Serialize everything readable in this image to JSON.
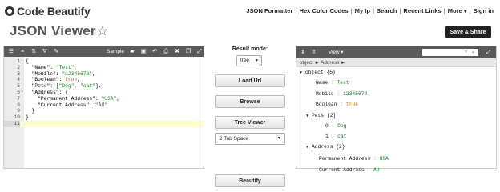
{
  "brand": {
    "name": "Code Beautify"
  },
  "nav": [
    "JSON Formatter",
    "Hex Color Codes",
    "My Ip",
    "Search",
    "Recent Links",
    "More ▾",
    "Sign in"
  ],
  "page": {
    "title": "JSON Viewer",
    "save_share": "Save & Share"
  },
  "editor": {
    "sample_label": "Sample",
    "line_numbers": [
      "1",
      "2",
      "3",
      "4",
      "5",
      "6",
      "7",
      "8",
      "9",
      "10",
      "11"
    ],
    "fold_markers": [
      "▾",
      "",
      "",
      "",
      "",
      "▾",
      "",
      "",
      "",
      "",
      ""
    ],
    "code": [
      {
        "parts": [
          [
            "k",
            "{"
          ]
        ]
      },
      {
        "parts": [
          [
            "k",
            "  \"Name\": "
          ],
          [
            "s",
            "\"Test\""
          ],
          [
            "k",
            ","
          ]
        ]
      },
      {
        "parts": [
          [
            "k",
            "  \"Mobile\": "
          ],
          [
            "s",
            "\"12345678\""
          ],
          [
            "k",
            ","
          ]
        ]
      },
      {
        "parts": [
          [
            "k",
            "  \"Boolean\": "
          ],
          [
            "b",
            "true"
          ],
          [
            "k",
            ","
          ]
        ]
      },
      {
        "parts": [
          [
            "k",
            "  \"Pets\": ["
          ],
          [
            "s",
            "\"Dog\""
          ],
          [
            "k",
            ", "
          ],
          [
            "s",
            "\"cat\""
          ],
          [
            "k",
            "],"
          ]
        ]
      },
      {
        "parts": [
          [
            "k",
            "  \"Address\": {"
          ]
        ]
      },
      {
        "parts": [
          [
            "k",
            "    \"Permanent Address\": "
          ],
          [
            "s",
            "\"USA\""
          ],
          [
            "k",
            ","
          ]
        ]
      },
      {
        "parts": [
          [
            "k",
            "    \"Current Address\": "
          ],
          [
            "s",
            "\"AU\""
          ]
        ]
      },
      {
        "parts": [
          [
            "k",
            "  }"
          ]
        ]
      },
      {
        "parts": [
          [
            "k",
            "}"
          ]
        ]
      },
      {
        "parts": [
          [
            "k",
            ""
          ]
        ]
      }
    ]
  },
  "middle": {
    "result_mode_label": "Result mode:",
    "result_mode_value": "tree",
    "load_url": "Load Url",
    "browse": "Browse",
    "tree_viewer": "Tree Viewer",
    "indent_value": "2 Tab Space",
    "beautify": "Beautify"
  },
  "viewer": {
    "view_label": "View",
    "breadcrumb": "object ► Address ►",
    "tree": [
      {
        "type": "node",
        "caret": "▼",
        "key": "object",
        "meta": "{5}"
      },
      {
        "type": "kv",
        "key": "Name",
        "value": "Test",
        "vclass": "str"
      },
      {
        "type": "kv",
        "key": "Mobile",
        "value": "12345678",
        "vclass": "str"
      },
      {
        "type": "kv",
        "key": "Boolean",
        "value": "true",
        "vclass": "bool"
      },
      {
        "type": "node",
        "caret": "▼",
        "key": "Pets",
        "meta": "[2]"
      },
      {
        "type": "kv",
        "key": "0",
        "value": "Dog",
        "vclass": "str"
      },
      {
        "type": "kv",
        "key": "1",
        "value": "cat",
        "vclass": "str"
      },
      {
        "type": "node",
        "caret": "▼",
        "key": "Address",
        "meta": "{2}"
      },
      {
        "type": "kv",
        "key": "Permanent Address",
        "value": "USA",
        "vclass": "str"
      },
      {
        "type": "kv",
        "key": "Current Address",
        "value": "AU",
        "vclass": "str"
      }
    ]
  }
}
